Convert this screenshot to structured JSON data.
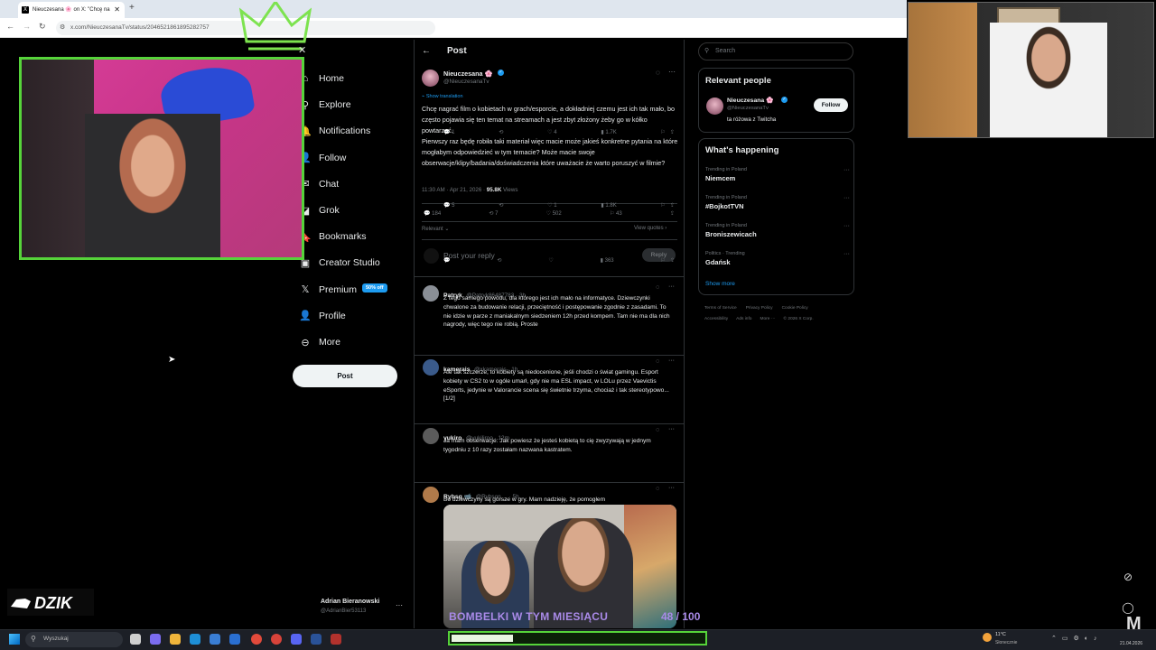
{
  "browser": {
    "tab_title": "Nieuczesana 🌸 on X: \"Chcę na",
    "url": "x.com/NieuczesanaTv/status/2046521861895282757"
  },
  "nav": {
    "items": [
      {
        "label": "Home",
        "icon": "home-icon",
        "glyph": "⌂"
      },
      {
        "label": "Explore",
        "icon": "search-icon",
        "glyph": "⚲"
      },
      {
        "label": "Notifications",
        "icon": "bell-icon",
        "glyph": "🔔"
      },
      {
        "label": "Follow",
        "icon": "follow-icon",
        "glyph": "👤"
      },
      {
        "label": "Chat",
        "icon": "chat-icon",
        "glyph": "✉"
      },
      {
        "label": "Grok",
        "icon": "grok-icon",
        "glyph": "◪"
      },
      {
        "label": "Bookmarks",
        "icon": "bookmark-icon",
        "glyph": "🔖"
      },
      {
        "label": "Creator Studio",
        "icon": "creator-studio-icon",
        "glyph": "▣"
      },
      {
        "label": "Premium",
        "icon": "x-logo-icon",
        "glyph": "𝕏"
      },
      {
        "label": "Profile",
        "icon": "profile-icon",
        "glyph": "👤"
      },
      {
        "label": "More",
        "icon": "more-icon",
        "glyph": "⊖"
      }
    ],
    "premium_badge": "50% off",
    "post_button": "Post",
    "account": {
      "name": "Adrian Bieranowski",
      "handle": "@AdrianBier53113"
    }
  },
  "main": {
    "header": "Post",
    "tweet": {
      "name": "Nieuczesana 🌸",
      "handle": "@NieuczesanaTv",
      "show_translation": "Show translation",
      "text": "Chcę nagrać film o kobietach w grach/esporcie, a dokładniej czemu jest ich tak mało, bo często pojawia się ten temat na streamach a jest zbyt złożony żeby go w kółko powtarzać.\nPierwszy raz będę robiła taki materiał więc macie może jakieś konkretne pytania na które mogłabym odpowiedzieć w tym temacie? Może macie swoje obserwacje/klipy/badania/doświadczenia które uważacie że warto poruszyć w filmie?",
      "time": "11:30 AM · Apr 21, 2026 ·",
      "views": "95.8K",
      "views_label": "Views",
      "replies": "184",
      "reposts": "7",
      "likes": "502",
      "bookmarks": "43",
      "sort": "Relevant",
      "view_quotes": "View quotes"
    },
    "reply_box": {
      "placeholder": "Post your reply",
      "button": "Reply"
    },
    "replies": [
      {
        "name": "Patryk",
        "handle": "@Patryk86487783 · 3h",
        "text": "Z tego samego powodu, dla którego jest ich mało na informatyce. Dziewczynki chwalone za budowanie relacji, przeciętność i postępowanie zgodnie z zasadami. To nie idzie w parze z maniakalnym siedzeniem 12h przed kompem. Tam nie ma dla nich nagrody, więc tego nie robią. Proste",
        "replies": "1",
        "reposts": "",
        "likes": "4",
        "views": "1.7K",
        "avatar": "#8a8f96"
      },
      {
        "name": "kamerais",
        "handle": "@xkamerais · 1h",
        "text": "Ale tak szczerze, to kobiety są niedocenione, jeśli chodzi o świat gamingu. Esport kobiety w CS2 to w ogóle umarł, gdy nie ma ESL impact, w LOLu przez Vaevictis eSports, jedynie w Valorancie scena się świetnie trzyma, chociaż i tak stereotypowo... [1/2]",
        "replies": "5",
        "reposts": "",
        "likes": "1",
        "views": "1.8K",
        "avatar": "#3a5a8a"
      },
      {
        "name": "yukiro",
        "handle": "@yukiliroo · 12m",
        "text": "Ja mam obserwacje: Jak powiesz że jesteś kobietą to cię zwyzywają w jednym tygodniu z 10 razy zostałam nazwana kastratem.",
        "replies": "",
        "reposts": "",
        "likes": "",
        "views": "363",
        "avatar": "#5b5b5b"
      },
      {
        "name": "Rybsq 📹",
        "handle": "@Rybson__ · 5h",
        "text": "Bo dziewczyny są gorsze w gry. Mam nadzieję, że pomogłem",
        "replies": "",
        "reposts": "",
        "likes": "",
        "views": "",
        "avatar": "#b07a4a"
      }
    ]
  },
  "right": {
    "search_placeholder": "Search",
    "relevant_title": "Relevant people",
    "person": {
      "name": "Nieuczesana 🌸",
      "handle": "@NieuczesanaTv",
      "bio": "ta różowa z Twitcha",
      "follow": "Follow"
    },
    "happening_title": "What's happening",
    "trends": [
      {
        "meta": "Trending in Poland",
        "name": "Niemcem"
      },
      {
        "meta": "Trending in Poland",
        "name": "#BojkotTVN"
      },
      {
        "meta": "Trending in Poland",
        "name": "Broniszewicach"
      },
      {
        "meta": "Politics · Trending",
        "name": "Gdańsk"
      }
    ],
    "show_more": "Show more",
    "footer1": [
      "Terms of Service",
      "Privacy Policy",
      "Cookie Policy"
    ],
    "footer2": [
      "Accessibility",
      "Ads info",
      "More ···",
      "© 2026 X Corp."
    ]
  },
  "overlay": {
    "brand": "DZIK",
    "goal_text": "BOMBELKI W TYM MIESIĄCU",
    "goal_count": "48 / 100",
    "goal_progress": 0.48
  },
  "taskbar": {
    "search": "Wyszukaj",
    "weather_temp": "11°C",
    "weather_desc": "Słonecznie",
    "date": "21.04.2026"
  },
  "colors": {
    "accent": "#1d9bf0",
    "overlay_green": "#56d33a",
    "goal_text": "#a98ae8"
  }
}
